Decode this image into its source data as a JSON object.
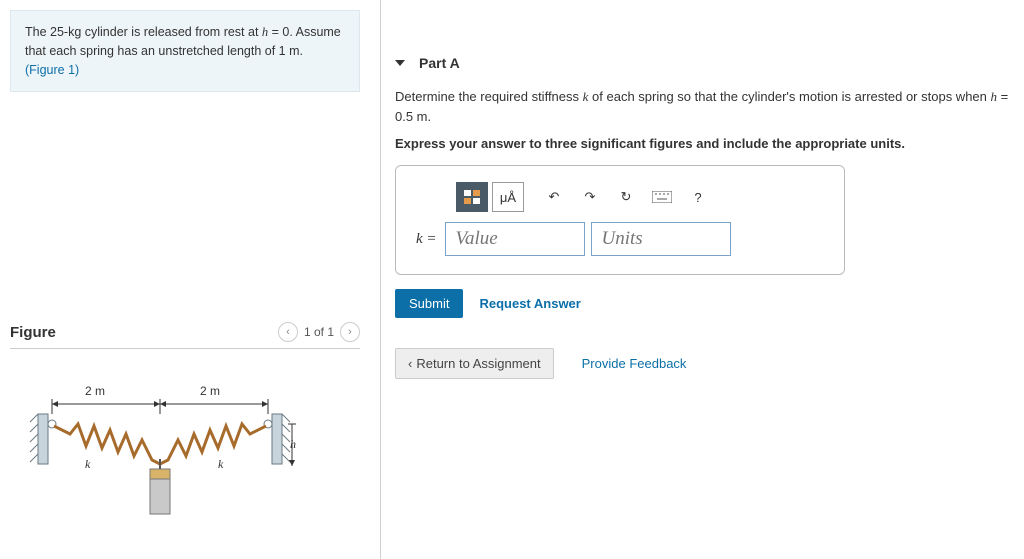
{
  "problem": {
    "text_before": "The 25-kg cylinder is released from rest at ",
    "var1": "h",
    "eq1": " = 0. Assume that each spring has an unstretched length of 1 m.",
    "figure_link": "(Figure 1)"
  },
  "figure": {
    "heading": "Figure",
    "pager": "1 of 1",
    "dim_left": "2 m",
    "dim_right": "2 m",
    "k_left": "k",
    "k_right": "k",
    "h_label": "h"
  },
  "partA": {
    "title": "Part A",
    "question_pre": "Determine the required stiffness ",
    "question_var": "k",
    "question_mid": " of each spring so that the cylinder's motion is arrested or stops when ",
    "question_h": "h",
    "question_end": " = 0.5 m.",
    "instruction": "Express your answer to three significant figures and include the appropriate units.",
    "k_equals": "k =",
    "value_ph": "Value",
    "units_ph": "Units",
    "toolbar_units_label": "μÅ",
    "toolbar_help": "?",
    "submit": "Submit",
    "request": "Request Answer"
  },
  "bottom": {
    "return_label": "Return to Assignment",
    "feedback": "Provide Feedback"
  }
}
